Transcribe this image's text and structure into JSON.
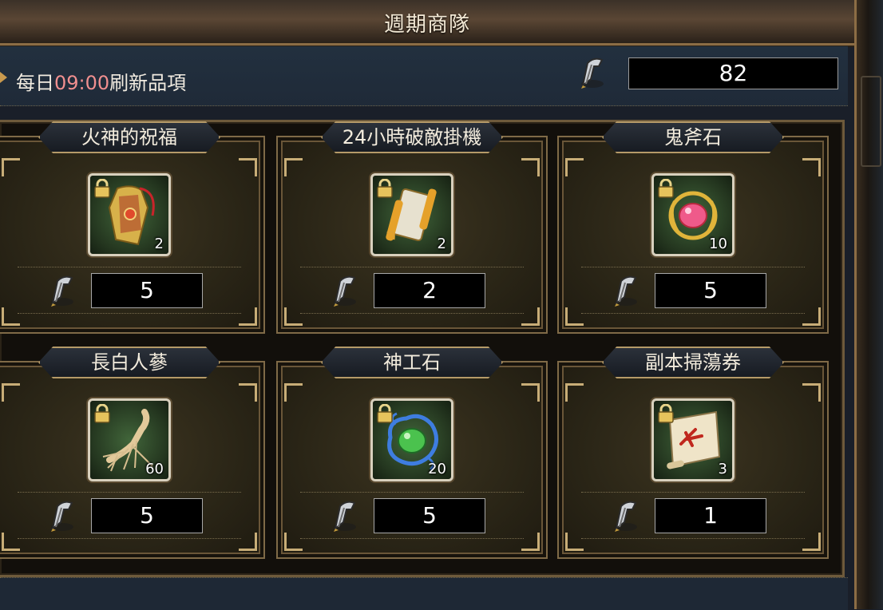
{
  "header": {
    "title": "週期商隊"
  },
  "info": {
    "refresh_prefix": "每日",
    "refresh_time": "09:00",
    "refresh_suffix": "刷新品項",
    "currency_total": "82",
    "currency_icon": "quill-token-icon"
  },
  "items": [
    {
      "name": "火神的祝福",
      "count": "2",
      "price": "5",
      "art": "amulet-icon",
      "locked": true
    },
    {
      "name": "24小時破敵掛機",
      "count": "2",
      "price": "2",
      "art": "scroll-icon",
      "locked": true
    },
    {
      "name": "鬼斧石",
      "count": "10",
      "price": "5",
      "art": "red-gem-icon",
      "locked": true
    },
    {
      "name": "長白人蔘",
      "count": "60",
      "price": "5",
      "art": "ginseng-icon",
      "locked": true
    },
    {
      "name": "神工石",
      "count": "20",
      "price": "5",
      "art": "green-gem-icon",
      "locked": true
    },
    {
      "name": "副本掃蕩券",
      "count": "3",
      "price": "1",
      "art": "map-scroll-icon",
      "locked": true
    }
  ],
  "colors": {
    "accent_gold": "#c8ad77",
    "time_highlight": "#f08f8f",
    "panel_bg": "#1f2a38"
  }
}
